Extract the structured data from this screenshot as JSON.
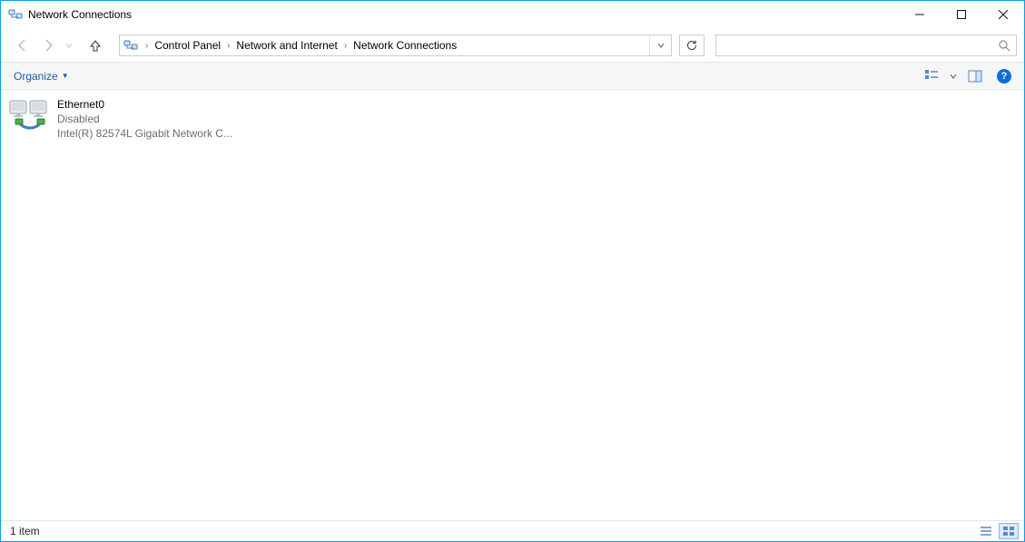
{
  "window": {
    "title": "Network Connections"
  },
  "nav": {
    "back_enabled": false,
    "forward_enabled": false
  },
  "address": {
    "crumbs": [
      "Control Panel",
      "Network and Internet",
      "Network Connections"
    ]
  },
  "search": {
    "placeholder": ""
  },
  "cmdbar": {
    "organize_label": "Organize"
  },
  "items": [
    {
      "name": "Ethernet0",
      "status": "Disabled",
      "device": "Intel(R) 82574L Gigabit Network C..."
    }
  ],
  "status": {
    "text": "1 item"
  }
}
